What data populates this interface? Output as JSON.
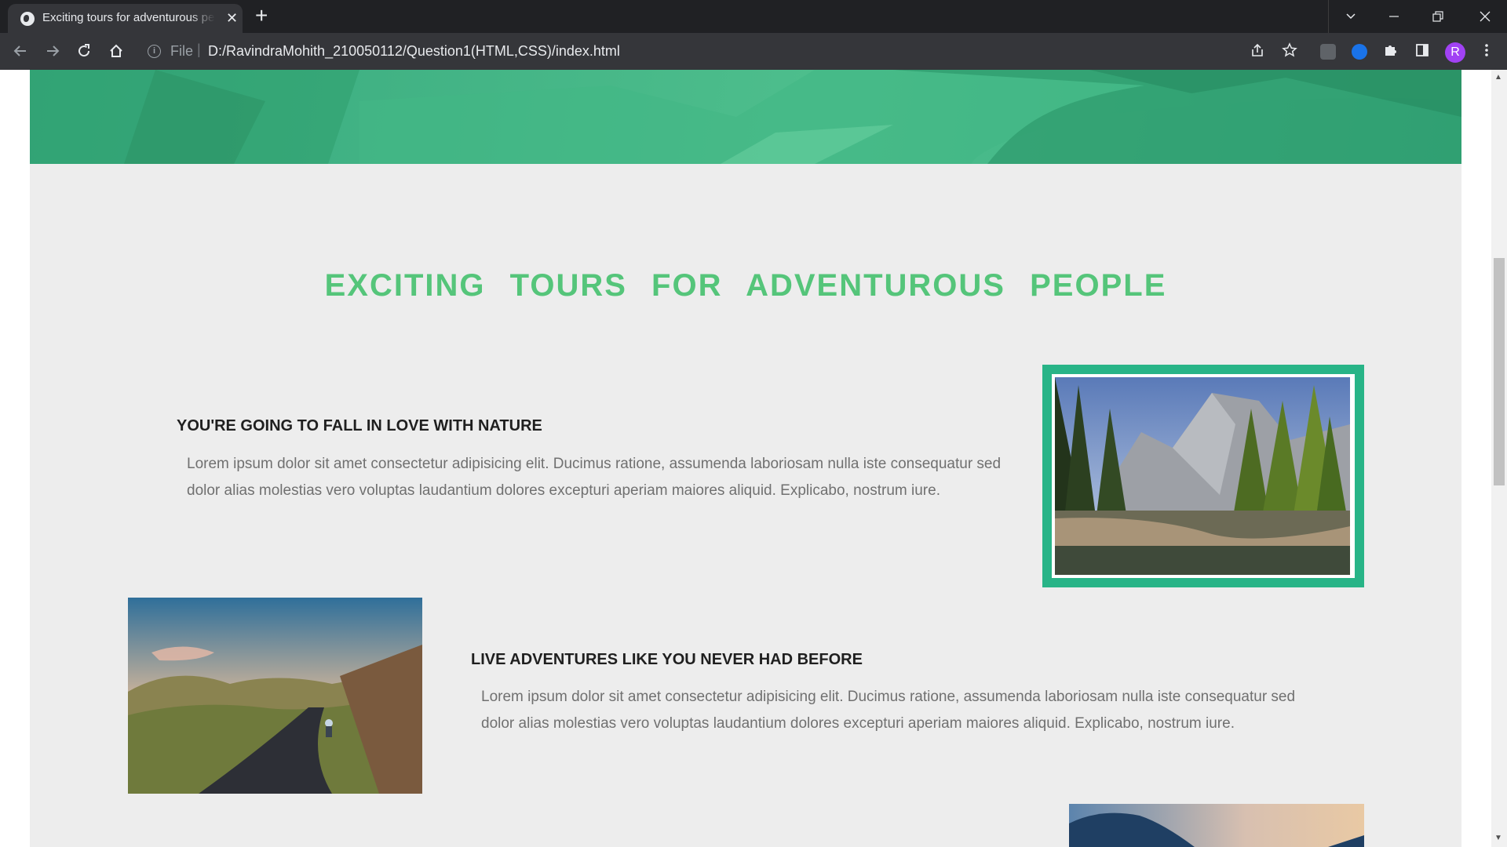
{
  "browser": {
    "tab_title": "Exciting tours for adventurous people",
    "tab_close": "✕",
    "new_tab": "+",
    "address_prefix": "File",
    "address_url": "D:/RavindraMohith_210050112/Question1(HTML,CSS)/index.html",
    "profile_initial": "R",
    "extension_colors": [
      "#5f6368",
      "#1a73e8"
    ]
  },
  "page": {
    "section_title": "EXCITING TOURS FOR ADVENTUROUS PEOPLE",
    "features": [
      {
        "heading": "YOU'RE GOING TO FALL IN LOVE WITH NATURE",
        "text": "Lorem ipsum dolor sit amet consectetur adipisicing elit. Ducimus ratione, assumenda laboriosam nulla iste consequatur sed dolor alias molestias vero voluptas laudantium dolores excepturi aperiam maiores aliquid. Explicabo, nostrum iure."
      },
      {
        "heading": "LIVE ADVENTURES LIKE YOU NEVER HAD BEFORE",
        "text": "Lorem ipsum dolor sit amet consectetur adipisicing elit. Ducimus ratione, assumenda laboriosam nulla iste consequatur sed dolor alias molestias vero voluptas laudantium dolores excepturi aperiam maiores aliquid. Explicabo, nostrum iure."
      }
    ],
    "colors": {
      "accent": "#55c57a",
      "frame": "#28b487",
      "background": "#ededed"
    }
  }
}
